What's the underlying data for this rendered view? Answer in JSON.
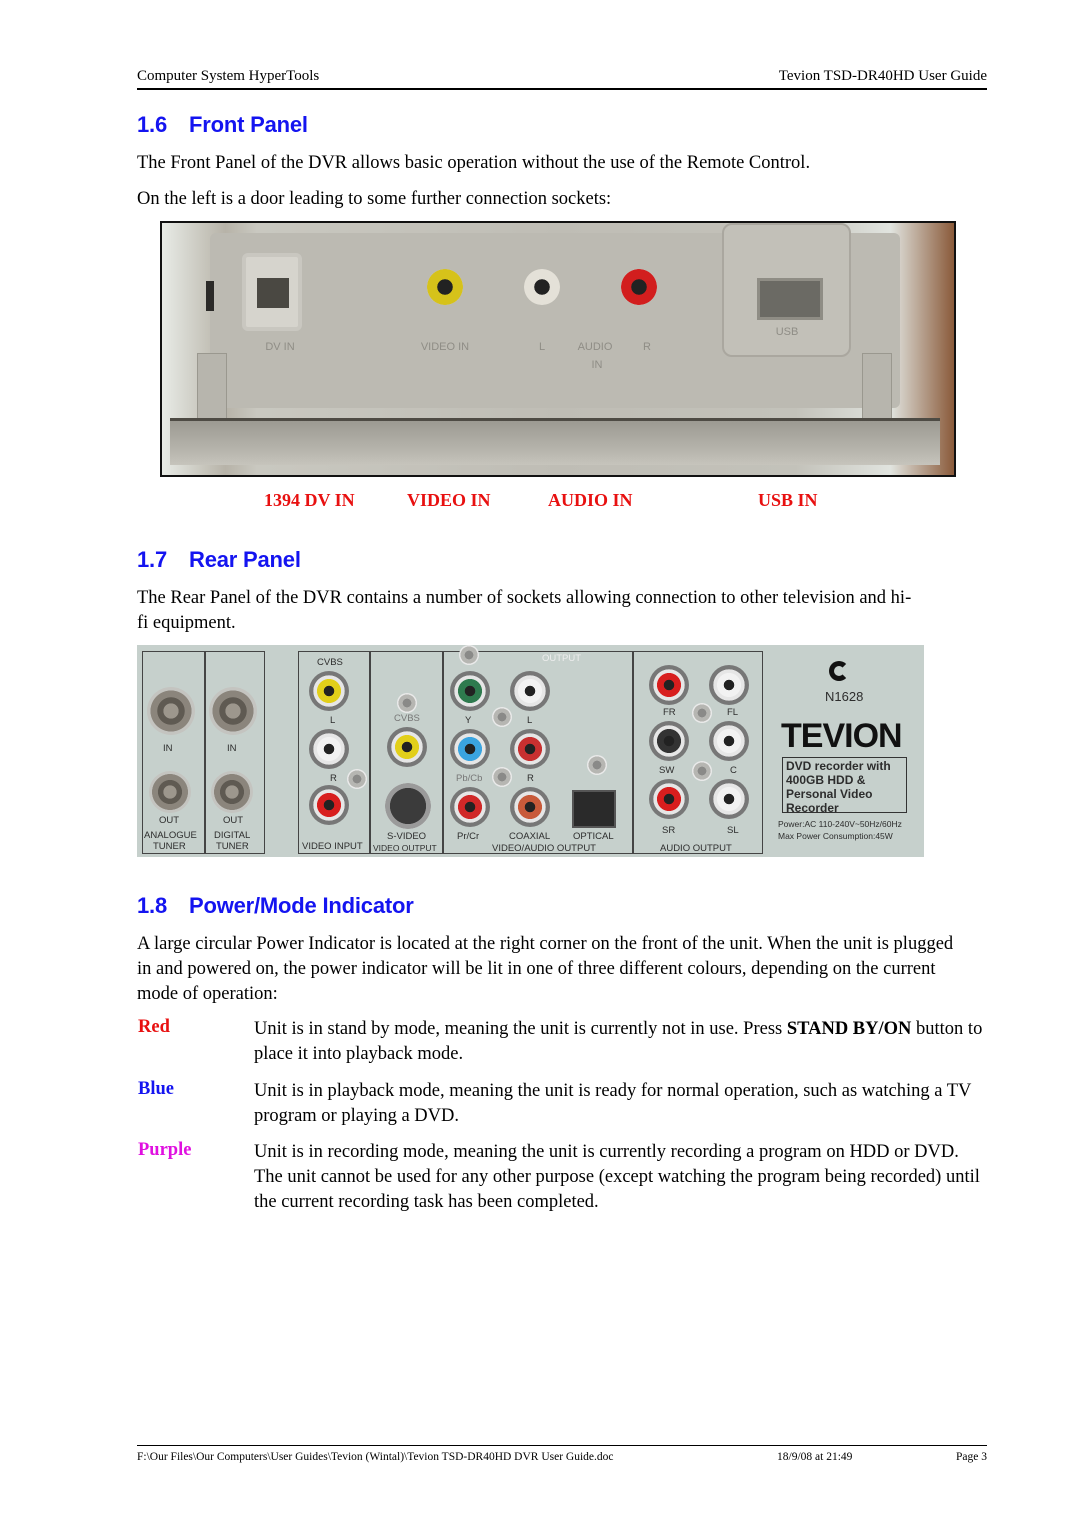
{
  "header": {
    "left": "Computer System HyperTools",
    "right": "Tevion TSD-DR40HD User Guide"
  },
  "sections": {
    "front_panel": {
      "number": "1.6",
      "title": "Front Panel",
      "paragraphs": [
        "The Front Panel of the DVR allows basic operation without the use of the Remote Control.",
        "On the left is a door leading to some further connection sockets:"
      ],
      "photo": {
        "printed_labels": [
          "DV IN",
          "VIDEO IN",
          "L",
          "AUDIO",
          "R",
          "IN",
          "USB"
        ]
      },
      "port_labels": [
        "1394 DV IN",
        "VIDEO IN",
        "AUDIO IN",
        "USB IN"
      ],
      "port_label_color": "#e81010"
    },
    "rear_panel": {
      "number": "1.7",
      "title": "Rear Panel",
      "paragraph": "The Rear Panel of the DVR contains a number of sockets allowing connection to other television and hi-fi equipment.",
      "photo": {
        "tuners": [
          {
            "in": "IN",
            "out": "OUT",
            "label1": "ANALOGUE",
            "label2": "TUNER"
          },
          {
            "in": "IN",
            "out": "OUT",
            "label1": "DIGITAL",
            "label2": "TUNER"
          }
        ],
        "video_input": {
          "cvbs": "CVBS",
          "l": "L",
          "r": "R",
          "label": "VIDEO INPUT"
        },
        "video_output": {
          "cvbs": "CVBS",
          "svideo": "S-VIDEO",
          "label": "VIDEO OUTPUT"
        },
        "va_output": {
          "top": "OUTPUT",
          "y": "Y",
          "l": "L",
          "pbcb": "Pb/Cb",
          "r": "R",
          "prcr": "Pr/Cr",
          "coaxial": "COAXIAL",
          "optical": "OPTICAL",
          "label": "VIDEO/AUDIO OUTPUT"
        },
        "audio_output": {
          "fr": "FR",
          "fl": "FL",
          "sw": "SW",
          "c": "C",
          "sr": "SR",
          "sl": "SL",
          "label": "AUDIO OUTPUT"
        },
        "model": "N1628",
        "brand": "TEVION",
        "spec_lines": [
          "DVD recorder with",
          "400GB HDD &",
          "Personal Video",
          "Recorder"
        ],
        "power_lines": [
          "Power:AC 110-240V~50Hz/60Hz",
          "Max Power Consumption:45W"
        ]
      }
    },
    "power_indicator": {
      "number": "1.8",
      "title": "Power/Mode Indicator",
      "paragraph": "A large circular Power Indicator is located at the right corner on the front of the unit. When the unit is plugged in and powered on, the power indicator will be lit in one of three different colours, depending on the current mode of operation:",
      "modes": [
        {
          "name": "Red",
          "color": "#e81010",
          "text_before": "Unit is in stand by mode, meaning the unit is currently not in use. Press ",
          "bold": "STAND BY/ON",
          "text_after": " button to place it into playback mode."
        },
        {
          "name": "Blue",
          "color": "#1414f0",
          "text": "Unit is in playback mode, meaning the unit is ready for normal operation, such as watching a TV program or playing a DVD."
        },
        {
          "name": "Purple",
          "color": "#e010e0",
          "text": "Unit is in recording mode, meaning the unit is currently recording a program on HDD or DVD. The unit cannot be used for any other purpose (except watching the program being recorded) until the current recording task has been completed."
        }
      ]
    }
  },
  "heading_color": "#1414f0",
  "footer": {
    "path": "F:\\Our Files\\Our Computers\\User Guides\\Tevion (Wintal)\\Tevion TSD-DR40HD DVR User Guide.doc",
    "date": "18/9/08 at 21:49",
    "page": "Page 3"
  }
}
